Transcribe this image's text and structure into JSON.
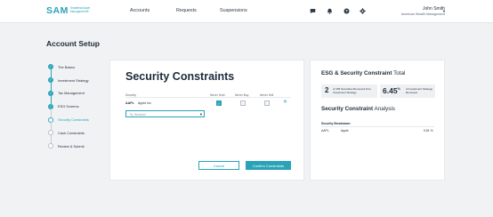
{
  "header": {
    "logo": {
      "mark": "SAM",
      "subtitle": "Smartleaf Asset Management®"
    },
    "nav": [
      "Accounts",
      "Requests",
      "Suspensions"
    ],
    "icons": [
      "chat-icon",
      "bell-icon",
      "help-icon",
      "gear-icon"
    ],
    "user": {
      "name": "John Smith",
      "org": "American Wealth Management"
    }
  },
  "page": {
    "title": "Account Setup"
  },
  "steps": [
    {
      "label": "The Basics",
      "state": "done"
    },
    {
      "label": "Investment Strategy",
      "state": "done"
    },
    {
      "label": "Tax Management",
      "state": "done"
    },
    {
      "label": "ESG Screens",
      "state": "done"
    },
    {
      "label": "Security Constraints",
      "state": "current"
    },
    {
      "label": "Cash Constraints",
      "state": "pending"
    },
    {
      "label": "Review & Submit",
      "state": "pending"
    }
  ],
  "constraints": {
    "title": "Security Constraints",
    "columns": [
      "Security",
      "Never Hold",
      "Never Buy",
      "Never Sell"
    ],
    "rows": [
      {
        "ticker": "AAPL",
        "name": "Apple Inc",
        "never_hold": true,
        "never_buy": false,
        "never_sell": false
      }
    ],
    "select_placeholder": "Try 'Amazon'",
    "cancel_label": "Cancel",
    "confirm_label": "Confirm Constraints"
  },
  "summary": {
    "heading_bold": "ESG & Security Constraint",
    "heading_rest": " Total",
    "metric1": {
      "value": "2",
      "text": "of 156 Securities Removed from Investment Strategy"
    },
    "metric2": {
      "value": "6.45",
      "unit": "%",
      "text": "of Investment Strategy Removed"
    },
    "analysis_bold": "Security Constraint",
    "analysis_rest": " Analysis",
    "breakdown_title": "Security Breakdown",
    "breakdown": [
      {
        "ticker": "AAPL",
        "name": "Apple",
        "pct": "5.81 %"
      }
    ]
  },
  "colors": {
    "accent": "#2aa3b8",
    "text": "#1c2b3a",
    "background": "#f1f2f4"
  }
}
